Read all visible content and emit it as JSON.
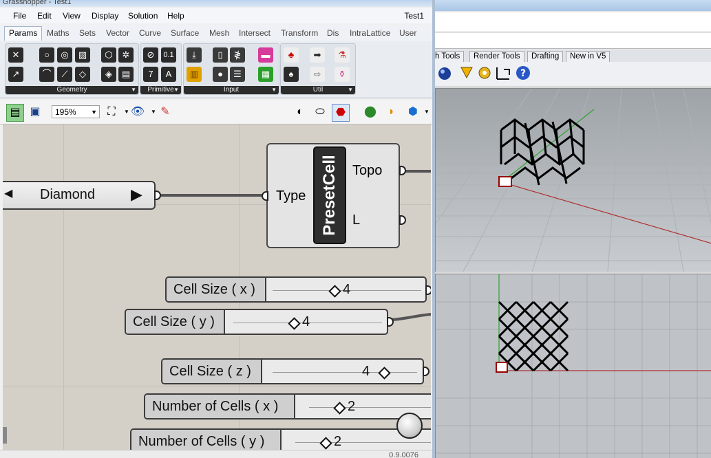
{
  "gh_title": "Grasshopper - Test1",
  "menu": [
    "File",
    "Edit",
    "View",
    "Display",
    "Solution",
    "Help"
  ],
  "doc_name": "Test1",
  "tabs": [
    "Params",
    "Maths",
    "Sets",
    "Vector",
    "Curve",
    "Surface",
    "Mesh",
    "Intersect",
    "Transform",
    "Dis",
    "IntraLattice",
    "User"
  ],
  "groups": [
    "Geometry",
    "Primitive",
    "Input",
    "Util"
  ],
  "zoom": "195%",
  "value_list": {
    "selected": "Diamond"
  },
  "presetcell": {
    "name": "PresetCell",
    "input": "Type",
    "outputs": [
      "Topo",
      "L"
    ]
  },
  "sliders": [
    {
      "label": "Cell Size ( x )",
      "value": "4"
    },
    {
      "label": "Cell Size ( y )",
      "value": "4"
    },
    {
      "label": "Cell Size ( z )",
      "value": "4"
    },
    {
      "label": "Number of Cells ( x )",
      "value": "2"
    },
    {
      "label": "Number of Cells ( y )",
      "value": "2"
    }
  ],
  "version": "0.9.0076",
  "rhino_tabs": [
    "h Tools",
    "Render Tools",
    "Drafting",
    "New in V5"
  ],
  "colors": {
    "accent": "#aebfd3",
    "canvas": "#d4d0c8",
    "wire": "#555555"
  }
}
